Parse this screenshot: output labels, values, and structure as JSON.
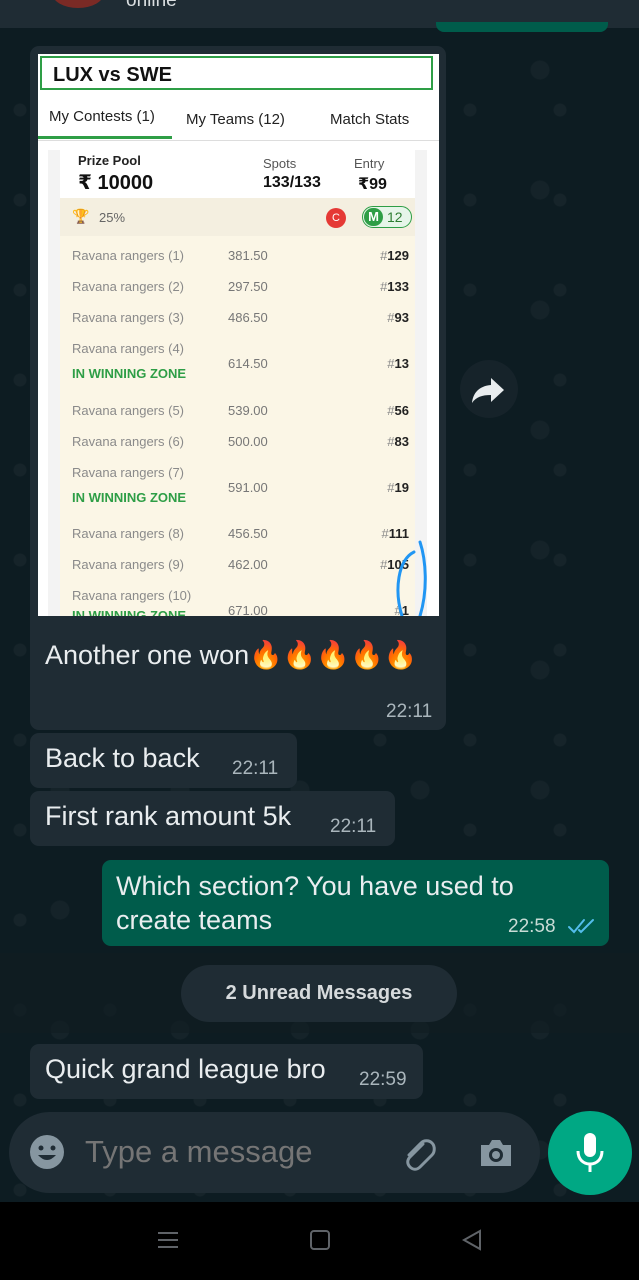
{
  "header": {
    "status_partial": "online"
  },
  "image_message": {
    "screenshot": {
      "title": "LUX vs SWE",
      "tabs": [
        "My Contests (1)",
        "My Teams (12)",
        "Match Stats"
      ],
      "prize_pool_label": "Prize Pool",
      "prize_pool_value": "₹ 10000",
      "spots_label": "Spots",
      "spots_value": "133/133",
      "entry_label": "Entry",
      "entry_value": "₹99",
      "winning_percent": "25%",
      "captain_badge": "C",
      "multi_badge": "M",
      "multi_count": "12",
      "winning_zone_label": "IN WINNING ZONE",
      "teams": [
        {
          "name": "Ravana rangers (1)",
          "points": "381.50",
          "rank": "129"
        },
        {
          "name": "Ravana rangers (2)",
          "points": "297.50",
          "rank": "133"
        },
        {
          "name": "Ravana rangers (3)",
          "points": "486.50",
          "rank": "93"
        },
        {
          "name": "Ravana rangers (4)",
          "points": "614.50",
          "rank": "13",
          "winning": true
        },
        {
          "name": "Ravana rangers (5)",
          "points": "539.00",
          "rank": "56"
        },
        {
          "name": "Ravana rangers (6)",
          "points": "500.00",
          "rank": "83"
        },
        {
          "name": "Ravana rangers (7)",
          "points": "591.00",
          "rank": "19",
          "winning": true
        },
        {
          "name": "Ravana rangers (8)",
          "points": "456.50",
          "rank": "111"
        },
        {
          "name": "Ravana rangers (9)",
          "points": "462.00",
          "rank": "105"
        },
        {
          "name": "Ravana rangers (10)",
          "points": "671.00",
          "rank": "1",
          "winning": true
        }
      ]
    },
    "caption": "Another one won🔥🔥🔥🔥🔥",
    "time": "22:11"
  },
  "messages": [
    {
      "text": "Back to back",
      "time": "22:11",
      "direction": "in"
    },
    {
      "text": "First rank amount 5k",
      "time": "22:11",
      "direction": "in"
    },
    {
      "text": "Which section? You have used to create teams",
      "time": "22:58",
      "direction": "out",
      "status": "read"
    },
    {
      "text": "Quick grand league bro",
      "time": "22:59",
      "direction": "in"
    }
  ],
  "unread_banner": "2 Unread Messages",
  "composer": {
    "placeholder": "Type a message"
  },
  "icons": {
    "forward": "forward-icon",
    "emoji": "emoji-icon",
    "attach": "paperclip-icon",
    "camera": "camera-icon",
    "mic": "microphone-icon",
    "read": "double-check-icon"
  },
  "colors": {
    "incoming": "#1f2c34",
    "outgoing": "#005c4b",
    "accent": "#00a884",
    "read_ticks": "#53bdeb"
  }
}
